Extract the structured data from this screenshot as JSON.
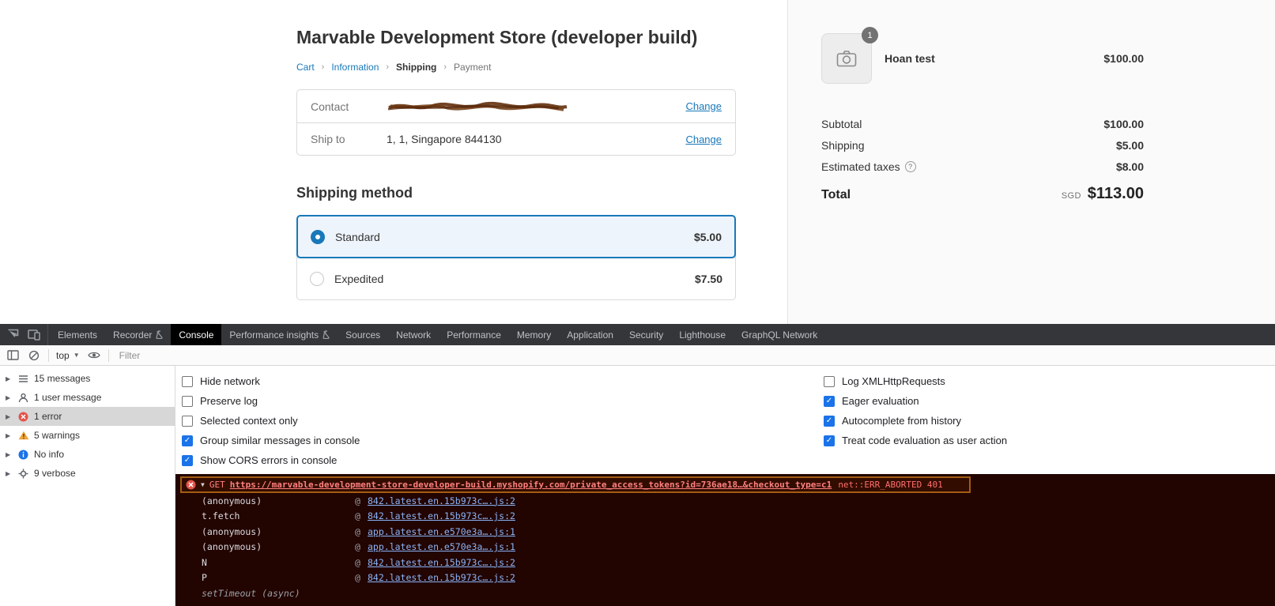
{
  "checkout": {
    "title": "Marvable Development Store (developer build)",
    "breadcrumb": {
      "separator": "›",
      "items": [
        {
          "label": "Cart",
          "state": "link"
        },
        {
          "label": "Information",
          "state": "link"
        },
        {
          "label": "Shipping",
          "state": "current"
        },
        {
          "label": "Payment",
          "state": "upcoming"
        }
      ]
    },
    "contact_card": {
      "rows": [
        {
          "label": "Contact",
          "value": "",
          "redacted": true,
          "action": "Change"
        },
        {
          "label": "Ship to",
          "value": "1, 1, Singapore 844130",
          "redacted": false,
          "action": "Change"
        }
      ]
    },
    "shipping": {
      "heading": "Shipping method",
      "options": [
        {
          "label": "Standard",
          "price": "$5.00",
          "selected": true
        },
        {
          "label": "Expedited",
          "price": "$7.50",
          "selected": false
        }
      ]
    }
  },
  "summary": {
    "item": {
      "name": "Hoan test",
      "quantity": "1",
      "price": "$100.00"
    },
    "rows": [
      {
        "label": "Subtotal",
        "value": "$100.00"
      },
      {
        "label": "Shipping",
        "value": "$5.00"
      },
      {
        "label": "Estimated taxes",
        "value": "$8.00",
        "has_info": true
      }
    ],
    "total": {
      "label": "Total",
      "currency": "SGD",
      "value": "$113.00"
    }
  },
  "devtools": {
    "tabs": [
      {
        "label": "Elements"
      },
      {
        "label": "Recorder",
        "flask": true
      },
      {
        "label": "Console",
        "active": true
      },
      {
        "label": "Performance insights",
        "flask": true
      },
      {
        "label": "Sources"
      },
      {
        "label": "Network"
      },
      {
        "label": "Performance"
      },
      {
        "label": "Memory"
      },
      {
        "label": "Application"
      },
      {
        "label": "Security"
      },
      {
        "label": "Lighthouse"
      },
      {
        "label": "GraphQL Network"
      }
    ],
    "toolbar": {
      "context": "top",
      "filter_placeholder": "Filter"
    },
    "sidebar": {
      "items": [
        {
          "label": "15 messages",
          "icon": "list-icon",
          "selected": false
        },
        {
          "label": "1 user message",
          "icon": "user-icon",
          "selected": false
        },
        {
          "label": "1 error",
          "icon": "error-icon",
          "selected": true
        },
        {
          "label": "5 warnings",
          "icon": "warning-icon",
          "selected": false
        },
        {
          "label": "No info",
          "icon": "info-icon",
          "selected": false
        },
        {
          "label": "9 verbose",
          "icon": "verbose-icon",
          "selected": false
        }
      ]
    },
    "settings": {
      "left": [
        {
          "label": "Hide network",
          "checked": false
        },
        {
          "label": "Preserve log",
          "checked": false
        },
        {
          "label": "Selected context only",
          "checked": false
        },
        {
          "label": "Group similar messages in console",
          "checked": true
        },
        {
          "label": "Show CORS errors in console",
          "checked": true
        }
      ],
      "right": [
        {
          "label": "Log XMLHttpRequests",
          "checked": false
        },
        {
          "label": "Eager evaluation",
          "checked": true
        },
        {
          "label": "Autocomplete from history",
          "checked": true
        },
        {
          "label": "Treat code evaluation as user action",
          "checked": true
        }
      ]
    },
    "log": {
      "error": {
        "method": "GET",
        "url": "https://marvable-development-store-developer-build.myshopify.com/private_access_tokens?id=736ae18…&checkout_type=c1",
        "status": "net::ERR_ABORTED 401"
      },
      "stack": [
        {
          "fn": "(anonymous)",
          "at": "@",
          "src": "842.latest.en.15b973c….js:2"
        },
        {
          "fn": "t.fetch",
          "at": "@",
          "src": "842.latest.en.15b973c….js:2"
        },
        {
          "fn": "(anonymous)",
          "at": "@",
          "src": "app.latest.en.e570e3a….js:1"
        },
        {
          "fn": "(anonymous)",
          "at": "@",
          "src": "app.latest.en.e570e3a….js:1"
        },
        {
          "fn": "N",
          "at": "@",
          "src": "842.latest.en.15b973c….js:2"
        },
        {
          "fn": "P",
          "at": "@",
          "src": "842.latest.en.15b973c….js:2"
        },
        {
          "fn": "setTimeout (async)",
          "at": "",
          "src": ""
        }
      ]
    }
  },
  "colors": {
    "accent_blue": "#1878b9",
    "devtools_strip": "#35363a",
    "checkbox_checked": "#1a73e8",
    "error_text": "#ff8080",
    "error_bg": "#330c00",
    "error_border": "#a35d14"
  }
}
